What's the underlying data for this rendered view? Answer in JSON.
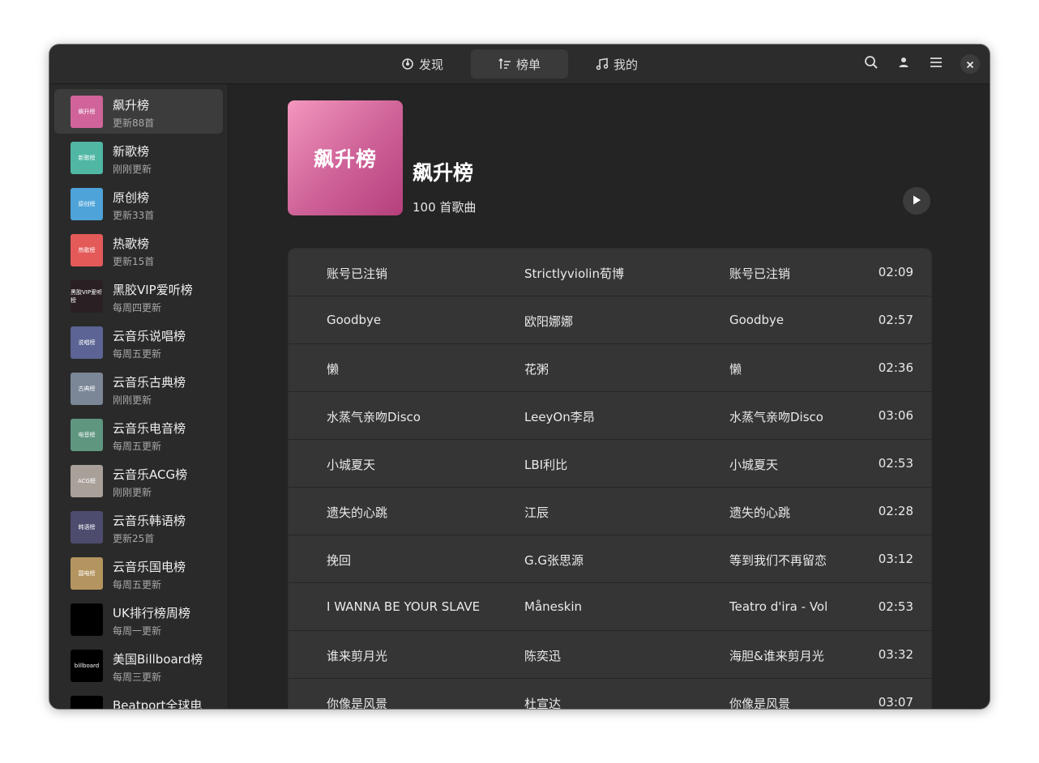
{
  "nav": {
    "tabs": [
      {
        "label": "发现",
        "icon": "discover-icon"
      },
      {
        "label": "榜单",
        "icon": "chart-list-icon"
      },
      {
        "label": "我的",
        "icon": "music-note-icon"
      }
    ],
    "active_tab": "榜单",
    "actions": [
      "search-icon",
      "user-icon",
      "menu-icon",
      "close-icon"
    ]
  },
  "sidebar": {
    "items": [
      {
        "title": "飙升榜",
        "subtitle": "更新88首",
        "thumb_text": "飙升榜",
        "thumb_color": "#d0649a",
        "active": true
      },
      {
        "title": "新歌榜",
        "subtitle": "刚刚更新",
        "thumb_text": "新歌榜",
        "thumb_color": "#4fb7a4"
      },
      {
        "title": "原创榜",
        "subtitle": "更新33首",
        "thumb_text": "原创榜",
        "thumb_color": "#4ea3d8"
      },
      {
        "title": "热歌榜",
        "subtitle": "更新15首",
        "thumb_text": "热歌榜",
        "thumb_color": "#e35a58"
      },
      {
        "title": "黑胶VIP爱听榜",
        "subtitle": "每周四更新",
        "thumb_text": "黑胶VIP爱听榜",
        "thumb_color": "#2a2024"
      },
      {
        "title": "云音乐说唱榜",
        "subtitle": "每周五更新",
        "thumb_text": "说唱榜",
        "thumb_color": "#5b6494"
      },
      {
        "title": "云音乐古典榜",
        "subtitle": "刚刚更新",
        "thumb_text": "古典榜",
        "thumb_color": "#7b8796"
      },
      {
        "title": "云音乐电音榜",
        "subtitle": "每周五更新",
        "thumb_text": "电音榜",
        "thumb_color": "#5e9680"
      },
      {
        "title": "云音乐ACG榜",
        "subtitle": "刚刚更新",
        "thumb_text": "ACG榜",
        "thumb_color": "#a9a09a"
      },
      {
        "title": "云音乐韩语榜",
        "subtitle": "更新25首",
        "thumb_text": "韩语榜",
        "thumb_color": "#4d4c6e"
      },
      {
        "title": "云音乐国电榜",
        "subtitle": "每周五更新",
        "thumb_text": "国电榜",
        "thumb_color": "#b4955f"
      },
      {
        "title": "UK排行榜周榜",
        "subtitle": "每周一更新",
        "thumb_text": "",
        "thumb_color": "#000000"
      },
      {
        "title": "美国Billboard榜",
        "subtitle": "每周三更新",
        "thumb_text": "billboard",
        "thumb_color": "#000000"
      },
      {
        "title": "Beatport全球电",
        "subtitle": "",
        "thumb_text": "",
        "thumb_color": "#000000"
      }
    ]
  },
  "playlist": {
    "cover_text": "飙升榜",
    "title": "飙升榜",
    "count": "100 首歌曲"
  },
  "songs": [
    {
      "title": "账号已注销",
      "artist": "Strictlyviolin荀博",
      "album": "账号已注销",
      "duration": "02:09"
    },
    {
      "title": "Goodbye",
      "artist": "欧阳娜娜",
      "album": "Goodbye",
      "duration": "02:57"
    },
    {
      "title": "懒",
      "artist": "花粥",
      "album": "懒",
      "duration": "02:36"
    },
    {
      "title": "水蒸气亲吻Disco",
      "artist": "LeeyOn李昂",
      "album": "水蒸气亲吻Disco",
      "duration": "03:06"
    },
    {
      "title": "小城夏天",
      "artist": "LBI利比",
      "album": "小城夏天",
      "duration": "02:53"
    },
    {
      "title": "遗失的心跳",
      "artist": "江辰",
      "album": "遗失的心跳",
      "duration": "02:28"
    },
    {
      "title": "挽回",
      "artist": "G.G张思源",
      "album": "等到我们不再留恋",
      "duration": "03:12"
    },
    {
      "title": "I WANNA BE YOUR SLAVE",
      "artist": "Måneskin",
      "album": "Teatro d'ira - Vol. I",
      "duration": "02:53"
    },
    {
      "title": "谁来剪月光",
      "artist": "陈奕迅",
      "album": "海胆&谁来剪月光",
      "duration": "03:32"
    },
    {
      "title": "你像是风景",
      "artist": "杜宣达",
      "album": "你像是风景",
      "duration": "03:07"
    }
  ]
}
